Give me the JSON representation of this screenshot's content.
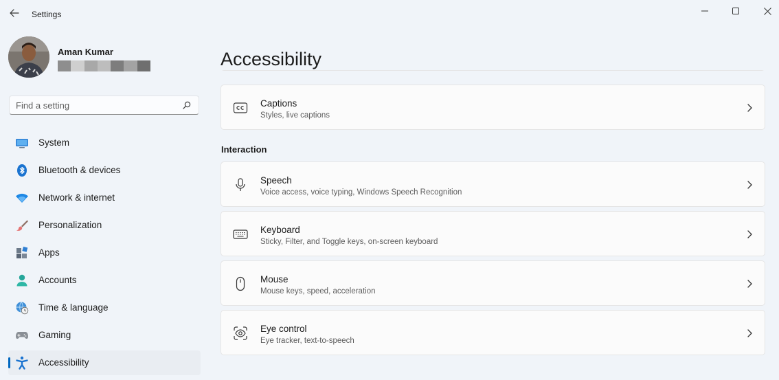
{
  "window": {
    "title": "Settings"
  },
  "profile": {
    "name": "Aman Kumar"
  },
  "search": {
    "placeholder": "Find a setting"
  },
  "nav": {
    "items": [
      {
        "label": "System",
        "icon": "monitor-icon",
        "selected": false
      },
      {
        "label": "Bluetooth & devices",
        "icon": "bluetooth-icon",
        "selected": false
      },
      {
        "label": "Network & internet",
        "icon": "wifi-icon",
        "selected": false
      },
      {
        "label": "Personalization",
        "icon": "paintbrush-icon",
        "selected": false
      },
      {
        "label": "Apps",
        "icon": "apps-icon",
        "selected": false
      },
      {
        "label": "Accounts",
        "icon": "person-icon",
        "selected": false
      },
      {
        "label": "Time & language",
        "icon": "globe-clock-icon",
        "selected": false
      },
      {
        "label": "Gaming",
        "icon": "gamepad-icon",
        "selected": false
      },
      {
        "label": "Accessibility",
        "icon": "accessibility-icon",
        "selected": true
      }
    ]
  },
  "main": {
    "title": "Accessibility",
    "captions": {
      "title": "Captions",
      "subtitle": "Styles, live captions",
      "icon": "closed-captions-icon"
    },
    "interaction_heading": "Interaction",
    "interaction": [
      {
        "title": "Speech",
        "subtitle": "Voice access, voice typing, Windows Speech Recognition",
        "icon": "microphone-icon"
      },
      {
        "title": "Keyboard",
        "subtitle": "Sticky, Filter, and Toggle keys, on-screen keyboard",
        "icon": "keyboard-icon"
      },
      {
        "title": "Mouse",
        "subtitle": "Mouse keys, speed, acceleration",
        "icon": "mouse-icon"
      },
      {
        "title": "Eye control",
        "subtitle": "Eye tracker, text-to-speech",
        "icon": "eye-control-icon"
      }
    ]
  },
  "colors": {
    "background": "#f0f4f9",
    "accent": "#0067c0",
    "card": "#fbfbfb"
  }
}
